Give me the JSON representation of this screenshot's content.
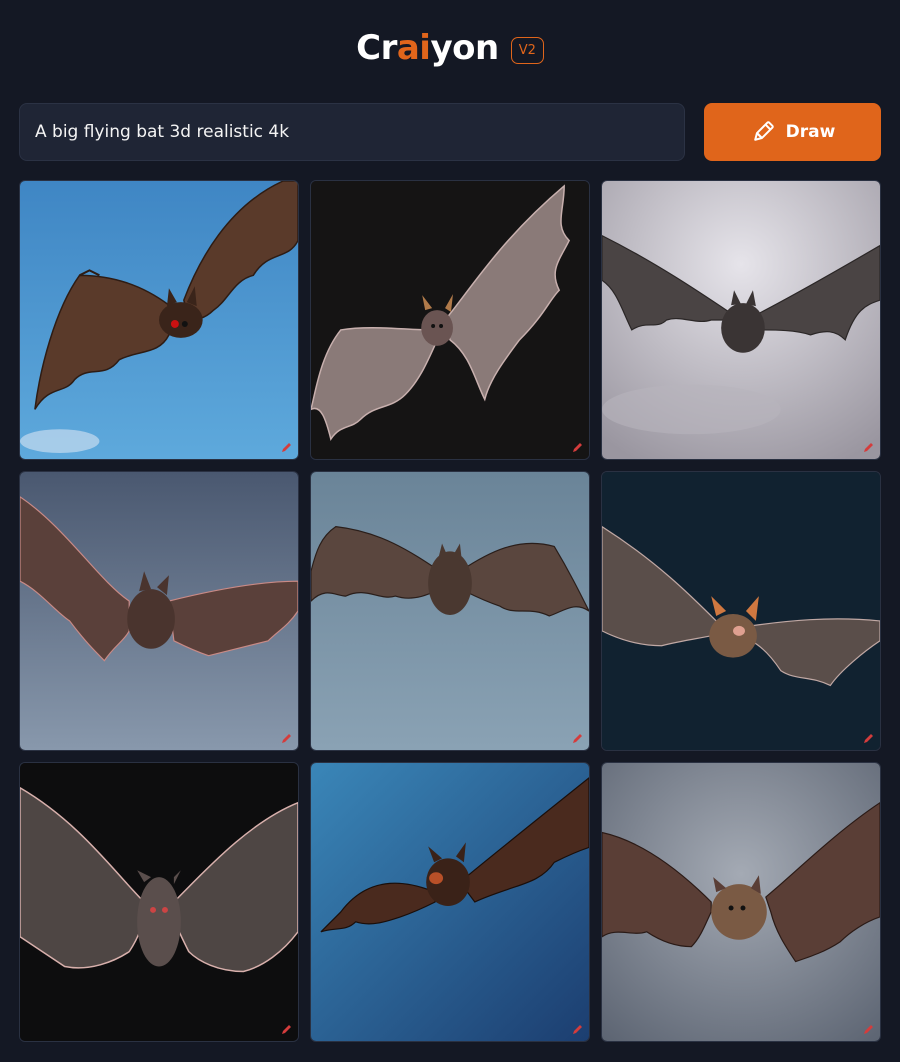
{
  "app": {
    "logo_parts": [
      "Cr",
      "ai",
      "yon"
    ],
    "version": "V2",
    "accent_color": "#e0651b"
  },
  "prompt": {
    "value": "A big flying bat 3d realistic 4k"
  },
  "draw_button": {
    "label": "Draw",
    "icon": "pencil-icon"
  },
  "results": [
    {
      "name": "bat-image-1",
      "background": "sky-blue",
      "bat": "brown"
    },
    {
      "name": "bat-image-2",
      "background": "black",
      "bat": "pinkish-gray"
    },
    {
      "name": "bat-image-3",
      "background": "cloudy-gray",
      "bat": "dark-gray"
    },
    {
      "name": "bat-image-4",
      "background": "slate-blue",
      "bat": "brown"
    },
    {
      "name": "bat-image-5",
      "background": "steel-blue",
      "bat": "brown"
    },
    {
      "name": "bat-image-6",
      "background": "dark-navy",
      "bat": "gray-brown"
    },
    {
      "name": "bat-image-7",
      "background": "black",
      "bat": "gray"
    },
    {
      "name": "bat-image-8",
      "background": "blue-gradient",
      "bat": "reddish-brown"
    },
    {
      "name": "bat-image-9",
      "background": "gray-gradient",
      "bat": "brown"
    }
  ],
  "tile_corner_icon": "pencil-icon"
}
